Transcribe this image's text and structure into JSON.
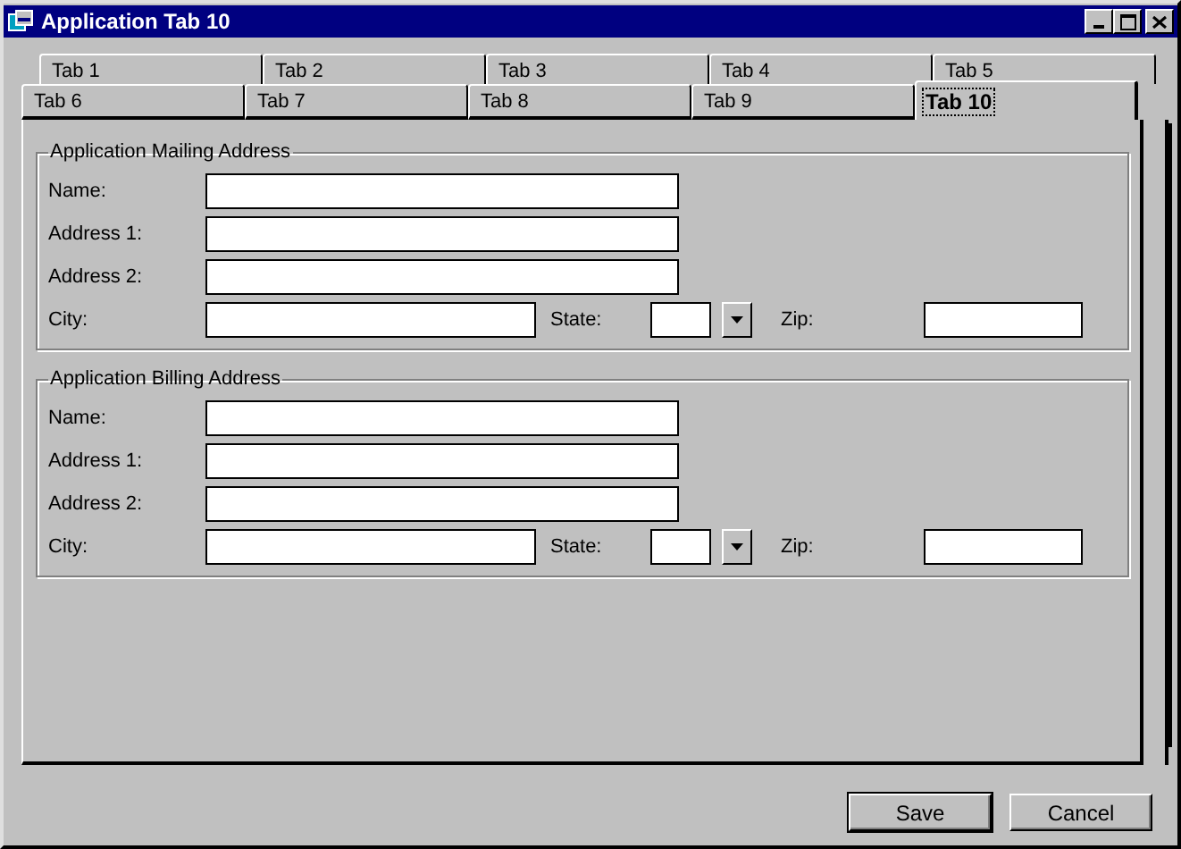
{
  "window": {
    "title": "Application Tab 10"
  },
  "tab_rows": [
    [
      {
        "label": "Tab 1",
        "selected": false
      },
      {
        "label": "Tab 2",
        "selected": false
      },
      {
        "label": "Tab 3",
        "selected": false
      },
      {
        "label": "Tab 4",
        "selected": false
      },
      {
        "label": "Tab 5",
        "selected": false
      }
    ],
    [
      {
        "label": "Tab 6",
        "selected": false
      },
      {
        "label": "Tab 7",
        "selected": false
      },
      {
        "label": "Tab 8",
        "selected": false
      },
      {
        "label": "Tab 9",
        "selected": false
      },
      {
        "label": "Tab 10",
        "selected": true
      }
    ]
  ],
  "groups": [
    {
      "title": "Application Mailing Address",
      "rows": [
        {
          "kind": "text",
          "label": "Name:"
        },
        {
          "kind": "text",
          "label": "Address 1:"
        },
        {
          "kind": "text",
          "label": "Address 2:"
        },
        {
          "kind": "city_state_zip",
          "city_label": "City:",
          "state_label": "State:",
          "zip_label": "Zip:"
        }
      ]
    },
    {
      "title": "Application Billing Address",
      "rows": [
        {
          "kind": "text",
          "label": "Name:"
        },
        {
          "kind": "text",
          "label": "Address 1:"
        },
        {
          "kind": "text",
          "label": "Address 2:"
        },
        {
          "kind": "city_state_zip",
          "city_label": "City:",
          "state_label": "State:",
          "zip_label": "Zip:"
        }
      ]
    }
  ],
  "buttons": [
    {
      "label": "Save",
      "default": true
    },
    {
      "label": "Cancel",
      "default": false
    }
  ]
}
